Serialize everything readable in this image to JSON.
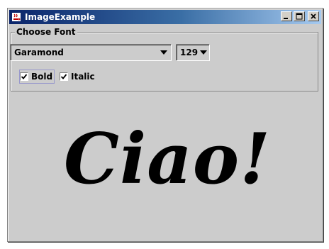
{
  "window": {
    "title": "ImageExample",
    "icon": "java-cup-icon"
  },
  "font_panel": {
    "legend": "Choose Font",
    "font_combo": {
      "selected": "Garamond"
    },
    "size_combo": {
      "selected": "129"
    },
    "bold": {
      "label": "Bold",
      "checked": true
    },
    "italic": {
      "label": "Italic",
      "checked": true
    }
  },
  "preview": {
    "text": "Ciao!"
  },
  "colors": {
    "window_bg": "#cccccc",
    "titlebar_start": "#0a246a",
    "titlebar_end": "#a6caf0"
  }
}
